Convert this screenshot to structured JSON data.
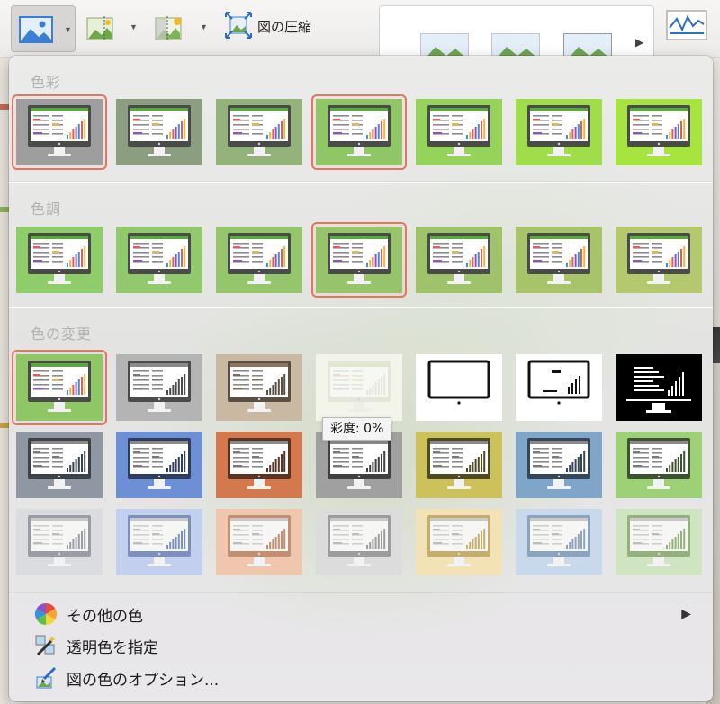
{
  "ribbon": {
    "compress_label": "図の圧縮",
    "icons": [
      "picture-color-icon",
      "remove-background-icon",
      "artistic-effects-icon",
      "compress-pictures-icon",
      "picture-styles-gallery",
      "sparkline-icon"
    ]
  },
  "menu": {
    "sections": [
      {
        "title": "色彩",
        "tiles": [
          {
            "bg": "#9e9e9e",
            "screen": "#4b4b4b",
            "mode": "color",
            "selected": true
          },
          {
            "bg": "#8b9e80",
            "screen": "#4b4b4b",
            "mode": "color",
            "selected": false
          },
          {
            "bg": "#93b37a",
            "screen": "#4b4b4b",
            "mode": "color",
            "selected": false
          },
          {
            "bg": "#8fc766",
            "screen": "#4b4b4b",
            "mode": "color",
            "selected": true
          },
          {
            "bg": "#95d35a",
            "screen": "#4b4b4b",
            "mode": "color",
            "selected": false
          },
          {
            "bg": "#9fdd4b",
            "screen": "#4b4b4b",
            "mode": "color",
            "selected": false
          },
          {
            "bg": "#a7e43f",
            "screen": "#4b4b4b",
            "mode": "color",
            "selected": false
          }
        ]
      },
      {
        "title": "色調",
        "tiles": [
          {
            "bg": "#8fcd6b",
            "screen": "#4b4b4b",
            "mode": "color",
            "selected": false
          },
          {
            "bg": "#92c96c",
            "screen": "#4b4b4b",
            "mode": "color",
            "selected": false
          },
          {
            "bg": "#95c66b",
            "screen": "#4b4b4b",
            "mode": "color",
            "selected": false
          },
          {
            "bg": "#97c46a",
            "screen": "#4b4b4b",
            "mode": "color",
            "selected": true
          },
          {
            "bg": "#9fc36a",
            "screen": "#4b4b4b",
            "mode": "color",
            "selected": false
          },
          {
            "bg": "#a7c468",
            "screen": "#4b4b4b",
            "mode": "color",
            "selected": false
          },
          {
            "bg": "#b4c86d",
            "screen": "#4b4b4b",
            "mode": "color",
            "selected": false
          }
        ]
      },
      {
        "title": "色の変更",
        "tiles": [
          {
            "bg": "#8fc766",
            "screen": "#4b4b4b",
            "mode": "color",
            "selected": true
          },
          {
            "bg": "#b4b4b4",
            "screen": "#4b4b4b",
            "mode": "gray",
            "selected": false
          },
          {
            "bg": "#c9b9a3",
            "screen": "#5a4f42",
            "mode": "sepia",
            "selected": false
          },
          {
            "bg": "#f3f5ea",
            "screen": "#e4e6dc",
            "mode": "washout",
            "selected": false
          },
          {
            "bg": "#ffffff",
            "screen": "#111111",
            "mode": "bw-outline",
            "selected": false
          },
          {
            "bg": "#ffffff",
            "screen": "#111111",
            "mode": "bw-sparse",
            "selected": false
          },
          {
            "bg": "#000000",
            "screen": "#ffffff",
            "mode": "bw-inverted",
            "selected": false
          },
          {
            "bg": "#8e97a2",
            "screen": "#3c424a",
            "mode": "gray",
            "selected": false
          },
          {
            "bg": "#6d8fd6",
            "screen": "#2e3c5e",
            "mode": "gray",
            "selected": false
          },
          {
            "bg": "#d4784e",
            "screen": "#5a3322",
            "mode": "gray",
            "selected": false
          },
          {
            "bg": "#a0a0a0",
            "screen": "#404040",
            "mode": "gray",
            "selected": false
          },
          {
            "bg": "#ccc15b",
            "screen": "#4e4a22",
            "mode": "gray",
            "selected": false
          },
          {
            "bg": "#7fa5c9",
            "screen": "#33465a",
            "mode": "gray",
            "selected": false
          },
          {
            "bg": "#9ed075",
            "screen": "#3c5230",
            "mode": "gray",
            "selected": false
          },
          {
            "bg": "#dadcdf",
            "screen": "#9a9ea4",
            "mode": "light",
            "selected": false
          },
          {
            "bg": "#c3cfee",
            "screen": "#7d8fbf",
            "mode": "light",
            "selected": false
          },
          {
            "bg": "#f0c7ae",
            "screen": "#c58e71",
            "mode": "light",
            "selected": false
          },
          {
            "bg": "#dcdcdc",
            "screen": "#9c9c9c",
            "mode": "light",
            "selected": false
          },
          {
            "bg": "#f3e2b5",
            "screen": "#c5ad6c",
            "mode": "light",
            "selected": false
          },
          {
            "bg": "#c8d9ec",
            "screen": "#8aa3c1",
            "mode": "light",
            "selected": false
          },
          {
            "bg": "#cfe4c0",
            "screen": "#93b07d",
            "mode": "light",
            "selected": false
          }
        ]
      }
    ],
    "tooltip": "彩度: 0%",
    "items": [
      {
        "label": "その他の色",
        "icon": "color-wheel-icon",
        "has_submenu": true
      },
      {
        "label": "透明色を指定",
        "icon": "magic-wand-icon",
        "has_submenu": false
      },
      {
        "label": "図の色のオプション...",
        "icon": "paint-brush-icon",
        "has_submenu": false
      }
    ]
  }
}
